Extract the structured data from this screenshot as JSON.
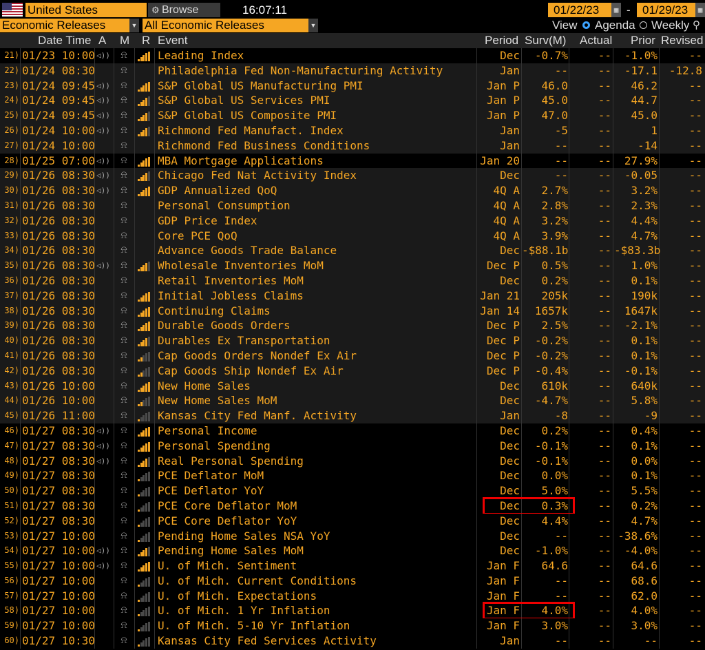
{
  "toolbar": {
    "country": "United States",
    "browse_label": "Browse",
    "clock": "16:07:11",
    "start_date": "01/22/23",
    "end_date": "01/29/23",
    "dash": "-"
  },
  "filters": {
    "category": "Economic Releases",
    "subcategory": "All Economic Releases",
    "view_label": "View",
    "agenda_label": "Agenda",
    "weekly_label": "Weekly"
  },
  "columns": {
    "datetime": "Date Time",
    "a": "A",
    "m": "M",
    "r": "R",
    "event": "Event",
    "period": "Period",
    "surv": "Surv(M)",
    "actual": "Actual",
    "prior": "Prior",
    "revised": "Revised"
  },
  "rows": [
    {
      "num": "21)",
      "dt": "01/23 10:00",
      "a": true,
      "r": 5,
      "event": "Leading Index",
      "period": "Dec",
      "surv": "-0.7%",
      "actual": "--",
      "prior": "-1.0%",
      "revised": "--",
      "bg": "dark"
    },
    {
      "num": "22)",
      "dt": "01/24 08:30",
      "a": false,
      "r": 0,
      "event": "Philadelphia Fed Non-Manufacturing Activity",
      "period": "Jan",
      "surv": "--",
      "actual": "--",
      "prior": "-17.1",
      "revised": "-12.8",
      "bg": "light"
    },
    {
      "num": "23)",
      "dt": "01/24 09:45",
      "a": true,
      "r": 5,
      "event": "S&P Global US Manufacturing PMI",
      "period": "Jan P",
      "surv": "46.0",
      "actual": "--",
      "prior": "46.2",
      "revised": "--",
      "bg": "light"
    },
    {
      "num": "24)",
      "dt": "01/24 09:45",
      "a": true,
      "r": 4,
      "event": "S&P Global US Services PMI",
      "period": "Jan P",
      "surv": "45.0",
      "actual": "--",
      "prior": "44.7",
      "revised": "--",
      "bg": "light"
    },
    {
      "num": "25)",
      "dt": "01/24 09:45",
      "a": true,
      "r": 4,
      "event": "S&P Global US Composite PMI",
      "period": "Jan P",
      "surv": "47.0",
      "actual": "--",
      "prior": "45.0",
      "revised": "--",
      "bg": "light"
    },
    {
      "num": "26)",
      "dt": "01/24 10:00",
      "a": true,
      "r": 4,
      "event": "Richmond Fed Manufact. Index",
      "period": "Jan",
      "surv": "-5",
      "actual": "--",
      "prior": "1",
      "revised": "--",
      "bg": "light"
    },
    {
      "num": "27)",
      "dt": "01/24 10:00",
      "a": false,
      "r": 0,
      "event": "Richmond Fed Business Conditions",
      "period": "Jan",
      "surv": "--",
      "actual": "--",
      "prior": "-14",
      "revised": "--",
      "bg": "light"
    },
    {
      "num": "28)",
      "dt": "01/25 07:00",
      "a": true,
      "r": 5,
      "event": "MBA Mortgage Applications",
      "period": "Jan 20",
      "surv": "--",
      "actual": "--",
      "prior": "27.9%",
      "revised": "--",
      "bg": "dark"
    },
    {
      "num": "29)",
      "dt": "01/26 08:30",
      "a": true,
      "r": 4,
      "event": "Chicago Fed Nat Activity Index",
      "period": "Dec",
      "surv": "--",
      "actual": "--",
      "prior": "-0.05",
      "revised": "--",
      "bg": "light"
    },
    {
      "num": "30)",
      "dt": "01/26 08:30",
      "a": true,
      "r": 5,
      "event": "GDP Annualized QoQ",
      "period": "4Q A",
      "surv": "2.7%",
      "actual": "--",
      "prior": "3.2%",
      "revised": "--",
      "bg": "light"
    },
    {
      "num": "31)",
      "dt": "01/26 08:30",
      "a": false,
      "r": 0,
      "event": "Personal Consumption",
      "period": "4Q A",
      "surv": "2.8%",
      "actual": "--",
      "prior": "2.3%",
      "revised": "--",
      "bg": "light"
    },
    {
      "num": "32)",
      "dt": "01/26 08:30",
      "a": false,
      "r": 0,
      "event": "GDP Price Index",
      "period": "4Q A",
      "surv": "3.2%",
      "actual": "--",
      "prior": "4.4%",
      "revised": "--",
      "bg": "light"
    },
    {
      "num": "33)",
      "dt": "01/26 08:30",
      "a": false,
      "r": 0,
      "event": "Core PCE QoQ",
      "period": "4Q A",
      "surv": "3.9%",
      "actual": "--",
      "prior": "4.7%",
      "revised": "--",
      "bg": "light"
    },
    {
      "num": "34)",
      "dt": "01/26 08:30",
      "a": false,
      "r": 0,
      "event": "Advance Goods Trade Balance",
      "period": "Dec",
      "surv": "-$88.1b",
      "actual": "--",
      "prior": "-$83.3b",
      "revised": "--",
      "bg": "light"
    },
    {
      "num": "35)",
      "dt": "01/26 08:30",
      "a": true,
      "r": 4,
      "event": "Wholesale Inventories MoM",
      "period": "Dec P",
      "surv": "0.5%",
      "actual": "--",
      "prior": "1.0%",
      "revised": "--",
      "bg": "light"
    },
    {
      "num": "36)",
      "dt": "01/26 08:30",
      "a": false,
      "r": 0,
      "event": "Retail Inventories MoM",
      "period": "Dec",
      "surv": "0.2%",
      "actual": "--",
      "prior": "0.1%",
      "revised": "--",
      "bg": "light"
    },
    {
      "num": "37)",
      "dt": "01/26 08:30",
      "a": false,
      "r": 5,
      "event": "Initial Jobless Claims",
      "period": "Jan 21",
      "surv": "205k",
      "actual": "--",
      "prior": "190k",
      "revised": "--",
      "bg": "light"
    },
    {
      "num": "38)",
      "dt": "01/26 08:30",
      "a": false,
      "r": 5,
      "event": "Continuing Claims",
      "period": "Jan 14",
      "surv": "1657k",
      "actual": "--",
      "prior": "1647k",
      "revised": "--",
      "bg": "light"
    },
    {
      "num": "39)",
      "dt": "01/26 08:30",
      "a": false,
      "r": 5,
      "event": "Durable Goods Orders",
      "period": "Dec P",
      "surv": "2.5%",
      "actual": "--",
      "prior": "-2.1%",
      "revised": "--",
      "bg": "light"
    },
    {
      "num": "40)",
      "dt": "01/26 08:30",
      "a": false,
      "r": 4,
      "event": "Durables Ex Transportation",
      "period": "Dec P",
      "surv": "-0.2%",
      "actual": "--",
      "prior": "0.1%",
      "revised": "--",
      "bg": "light"
    },
    {
      "num": "41)",
      "dt": "01/26 08:30",
      "a": false,
      "r": 2,
      "event": "Cap Goods Orders Nondef Ex Air",
      "period": "Dec P",
      "surv": "-0.2%",
      "actual": "--",
      "prior": "0.1%",
      "revised": "--",
      "bg": "light"
    },
    {
      "num": "42)",
      "dt": "01/26 08:30",
      "a": false,
      "r": 2,
      "event": "Cap Goods Ship Nondef Ex Air",
      "period": "Dec P",
      "surv": "-0.4%",
      "actual": "--",
      "prior": "-0.1%",
      "revised": "--",
      "bg": "light"
    },
    {
      "num": "43)",
      "dt": "01/26 10:00",
      "a": false,
      "r": 5,
      "event": "New Home Sales",
      "period": "Dec",
      "surv": "610k",
      "actual": "--",
      "prior": "640k",
      "revised": "--",
      "bg": "light"
    },
    {
      "num": "44)",
      "dt": "01/26 10:00",
      "a": false,
      "r": 2,
      "event": "New Home Sales MoM",
      "period": "Dec",
      "surv": "-4.7%",
      "actual": "--",
      "prior": "5.8%",
      "revised": "--",
      "bg": "light"
    },
    {
      "num": "45)",
      "dt": "01/26 11:00",
      "a": false,
      "r": 1,
      "event": "Kansas City Fed Manf. Activity",
      "period": "Jan",
      "surv": "-8",
      "actual": "--",
      "prior": "-9",
      "revised": "--",
      "bg": "light"
    },
    {
      "num": "46)",
      "dt": "01/27 08:30",
      "a": true,
      "r": 5,
      "event": "Personal Income",
      "period": "Dec",
      "surv": "0.2%",
      "actual": "--",
      "prior": "0.4%",
      "revised": "--",
      "bg": "dark"
    },
    {
      "num": "47)",
      "dt": "01/27 08:30",
      "a": true,
      "r": 5,
      "event": "Personal Spending",
      "period": "Dec",
      "surv": "-0.1%",
      "actual": "--",
      "prior": "0.1%",
      "revised": "--",
      "bg": "dark"
    },
    {
      "num": "48)",
      "dt": "01/27 08:30",
      "a": true,
      "r": 4,
      "event": "Real Personal Spending",
      "period": "Dec",
      "surv": "-0.1%",
      "actual": "--",
      "prior": "0.0%",
      "revised": "--",
      "bg": "dark"
    },
    {
      "num": "49)",
      "dt": "01/27 08:30",
      "a": false,
      "r": 1,
      "event": "PCE Deflator MoM",
      "period": "Dec",
      "surv": "0.0%",
      "actual": "--",
      "prior": "0.1%",
      "revised": "--",
      "bg": "dark"
    },
    {
      "num": "50)",
      "dt": "01/27 08:30",
      "a": false,
      "r": 1,
      "event": "PCE Deflator YoY",
      "period": "Dec",
      "surv": "5.0%",
      "actual": "--",
      "prior": "5.5%",
      "revised": "--",
      "bg": "dark"
    },
    {
      "num": "51)",
      "dt": "01/27 08:30",
      "a": false,
      "r": 1,
      "event": "PCE Core Deflator MoM",
      "period": "Dec",
      "surv": "0.3%",
      "actual": "--",
      "prior": "0.2%",
      "revised": "--",
      "bg": "dark"
    },
    {
      "num": "52)",
      "dt": "01/27 08:30",
      "a": false,
      "r": 1,
      "event": "PCE Core Deflator YoY",
      "period": "Dec",
      "surv": "4.4%",
      "actual": "--",
      "prior": "4.7%",
      "revised": "--",
      "bg": "dark"
    },
    {
      "num": "53)",
      "dt": "01/27 10:00",
      "a": false,
      "r": 1,
      "event": "Pending Home Sales NSA YoY",
      "period": "Dec",
      "surv": "--",
      "actual": "--",
      "prior": "-38.6%",
      "revised": "--",
      "bg": "dark"
    },
    {
      "num": "54)",
      "dt": "01/27 10:00",
      "a": true,
      "r": 4,
      "event": "Pending Home Sales MoM",
      "period": "Dec",
      "surv": "-1.0%",
      "actual": "--",
      "prior": "-4.0%",
      "revised": "--",
      "bg": "dark"
    },
    {
      "num": "55)",
      "dt": "01/27 10:00",
      "a": true,
      "r": 5,
      "event": "U. of Mich. Sentiment",
      "period": "Jan F",
      "surv": "64.6",
      "actual": "--",
      "prior": "64.6",
      "revised": "--",
      "bg": "dark"
    },
    {
      "num": "56)",
      "dt": "01/27 10:00",
      "a": false,
      "r": 1,
      "event": "U. of Mich. Current Conditions",
      "period": "Jan F",
      "surv": "--",
      "actual": "--",
      "prior": "68.6",
      "revised": "--",
      "bg": "dark"
    },
    {
      "num": "57)",
      "dt": "01/27 10:00",
      "a": false,
      "r": 1,
      "event": "U. of Mich. Expectations",
      "period": "Jan F",
      "surv": "--",
      "actual": "--",
      "prior": "62.0",
      "revised": "--",
      "bg": "dark"
    },
    {
      "num": "58)",
      "dt": "01/27 10:00",
      "a": false,
      "r": 1,
      "event": "U. of Mich. 1 Yr Inflation",
      "period": "Jan F",
      "surv": "4.0%",
      "actual": "--",
      "prior": "4.0%",
      "revised": "--",
      "bg": "dark"
    },
    {
      "num": "59)",
      "dt": "01/27 10:00",
      "a": false,
      "r": 1,
      "event": "U. of Mich. 5-10 Yr Inflation",
      "period": "Jan F",
      "surv": "3.0%",
      "actual": "--",
      "prior": "3.0%",
      "revised": "--",
      "bg": "dark"
    },
    {
      "num": "60)",
      "dt": "01/27 10:30",
      "a": false,
      "r": 1,
      "event": "Kansas City Fed Services Activity",
      "period": "Jan",
      "surv": "--",
      "actual": "--",
      "prior": "--",
      "revised": "--",
      "bg": "dark"
    }
  ],
  "highlights": [
    "51)",
    "58)"
  ],
  "colors": {
    "accent": "#f5a623",
    "highlight": "#ee0000",
    "header_bg": "#232323",
    "row_light": "#1a1a1a"
  }
}
